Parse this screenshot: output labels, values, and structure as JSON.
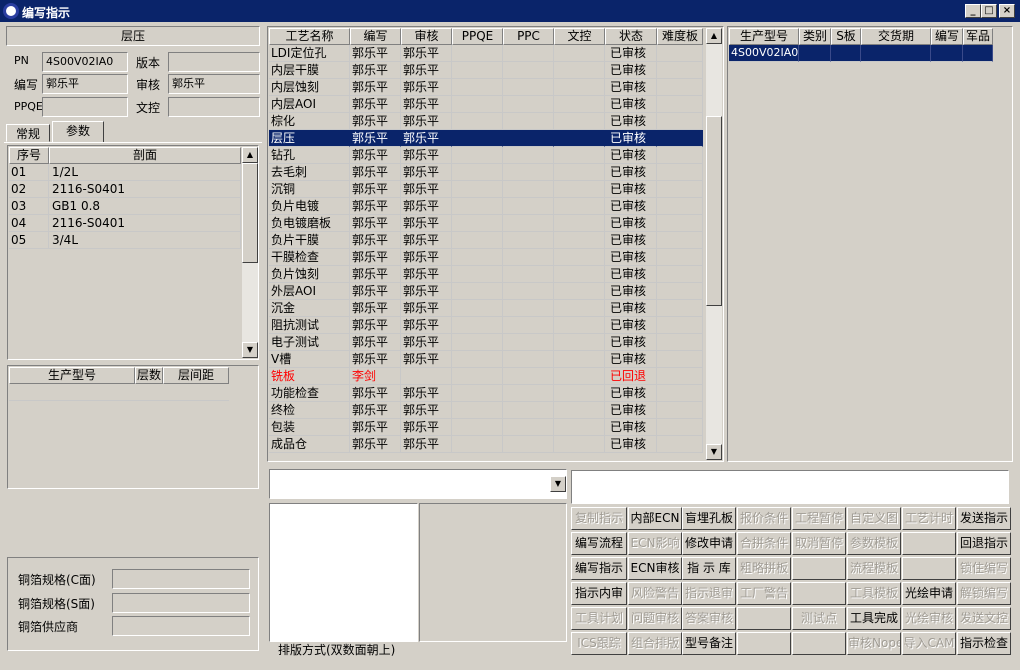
{
  "window": {
    "title": "编写指示",
    "min": "_",
    "max": "□",
    "close": "×"
  },
  "left": {
    "section_title": "层压",
    "pn_label": "PN",
    "pn_value": "4S00V02IA0",
    "version_label": "版本",
    "version_value": "",
    "writer_label": "编写",
    "writer_value": "郭乐平",
    "reviewer_label": "审核",
    "reviewer_value": "郭乐平",
    "ppqe_label": "PPQE",
    "ppqe_value": "",
    "doccontrol_label": "文控",
    "doccontrol_value": "",
    "tabs": [
      {
        "label": "常规"
      },
      {
        "label": "参数"
      }
    ],
    "profile_headers": {
      "seq": "序号",
      "section": "剖面"
    },
    "profiles": [
      {
        "seq": "01",
        "section": "1/2L"
      },
      {
        "seq": "02",
        "section": "2116-S0401"
      },
      {
        "seq": "03",
        "section": "GB1  0.8"
      },
      {
        "seq": "04",
        "section": "2116-S0401"
      },
      {
        "seq": "05",
        "section": "3/4L"
      }
    ],
    "layer_headers": {
      "model": "生产型号",
      "layers": "层数",
      "spacing": "层间距"
    },
    "copper_c_label": "铜箔规格(C面)",
    "copper_c_value": "",
    "copper_s_label": "铜箔规格(S面)",
    "copper_s_value": "",
    "copper_supplier_label": "铜箔供应商",
    "copper_supplier_value": ""
  },
  "process_table": {
    "headers": [
      "工艺名称",
      "编写",
      "审核",
      "PPQE",
      "PPC",
      "文控",
      "状态",
      "难度板"
    ],
    "rows": [
      {
        "name": "LDI定位孔",
        "writer": "郭乐平",
        "reviewer": "郭乐平",
        "status": "已审核"
      },
      {
        "name": "内层干膜",
        "writer": "郭乐平",
        "reviewer": "郭乐平",
        "status": "已审核"
      },
      {
        "name": "内层蚀刻",
        "writer": "郭乐平",
        "reviewer": "郭乐平",
        "status": "已审核"
      },
      {
        "name": "内层AOI",
        "writer": "郭乐平",
        "reviewer": "郭乐平",
        "status": "已审核"
      },
      {
        "name": "棕化",
        "writer": "郭乐平",
        "reviewer": "郭乐平",
        "status": "已审核"
      },
      {
        "name": "层压",
        "writer": "郭乐平",
        "reviewer": "郭乐平",
        "status": "已审核",
        "selected": true
      },
      {
        "name": "钻孔",
        "writer": "郭乐平",
        "reviewer": "郭乐平",
        "status": "已审核"
      },
      {
        "name": "去毛刺",
        "writer": "郭乐平",
        "reviewer": "郭乐平",
        "status": "已审核"
      },
      {
        "name": "沉铜",
        "writer": "郭乐平",
        "reviewer": "郭乐平",
        "status": "已审核"
      },
      {
        "name": "负片电镀",
        "writer": "郭乐平",
        "reviewer": "郭乐平",
        "status": "已审核"
      },
      {
        "name": "负电镀磨板",
        "writer": "郭乐平",
        "reviewer": "郭乐平",
        "status": "已审核"
      },
      {
        "name": "负片干膜",
        "writer": "郭乐平",
        "reviewer": "郭乐平",
        "status": "已审核"
      },
      {
        "name": "干膜检查",
        "writer": "郭乐平",
        "reviewer": "郭乐平",
        "status": "已审核"
      },
      {
        "name": "负片蚀刻",
        "writer": "郭乐平",
        "reviewer": "郭乐平",
        "status": "已审核"
      },
      {
        "name": "外层AOI",
        "writer": "郭乐平",
        "reviewer": "郭乐平",
        "status": "已审核"
      },
      {
        "name": "沉金",
        "writer": "郭乐平",
        "reviewer": "郭乐平",
        "status": "已审核"
      },
      {
        "name": "阻抗测试",
        "writer": "郭乐平",
        "reviewer": "郭乐平",
        "status": "已审核"
      },
      {
        "name": "电子测试",
        "writer": "郭乐平",
        "reviewer": "郭乐平",
        "status": "已审核"
      },
      {
        "name": "V槽",
        "writer": "郭乐平",
        "reviewer": "郭乐平",
        "status": "已审核"
      },
      {
        "name": "铣板",
        "writer": "李剑",
        "reviewer": "",
        "status": "已回退",
        "returned": true
      },
      {
        "name": "功能检查",
        "writer": "郭乐平",
        "reviewer": "郭乐平",
        "status": "已审核"
      },
      {
        "name": "终检",
        "writer": "郭乐平",
        "reviewer": "郭乐平",
        "status": "已审核"
      },
      {
        "name": "包装",
        "writer": "郭乐平",
        "reviewer": "郭乐平",
        "status": "已审核"
      },
      {
        "name": "成品仓",
        "writer": "郭乐平",
        "reviewer": "郭乐平",
        "status": "已审核"
      }
    ]
  },
  "model_table": {
    "headers": [
      "生产型号",
      "类别",
      "S板",
      "交货期",
      "编写",
      "军品"
    ],
    "rows": [
      {
        "model": "4S00V02IA0"
      }
    ]
  },
  "layout_label": "排版方式(双数面朝上)",
  "buttons": [
    [
      {
        "label": "复制指示",
        "enabled": false
      },
      {
        "label": "内部ECN",
        "enabled": true
      },
      {
        "label": "盲埋孔板",
        "enabled": true
      },
      {
        "label": "报价条件",
        "enabled": false
      },
      {
        "label": "工程暂停",
        "enabled": false
      },
      {
        "label": "自定义图",
        "enabled": false
      },
      {
        "label": "工艺计时",
        "enabled": false
      },
      {
        "label": "发送指示",
        "enabled": true
      }
    ],
    [
      {
        "label": "编写流程",
        "enabled": true
      },
      {
        "label": "ECN影响",
        "enabled": false
      },
      {
        "label": "修改申请",
        "enabled": true
      },
      {
        "label": "合拼条件",
        "enabled": false
      },
      {
        "label": "取消暂停",
        "enabled": false
      },
      {
        "label": "参数模板",
        "enabled": false
      },
      {
        "label": "",
        "enabled": false
      },
      {
        "label": "回退指示",
        "enabled": true
      }
    ],
    [
      {
        "label": "编写指示",
        "enabled": true
      },
      {
        "label": "ECN审核",
        "enabled": true
      },
      {
        "label": "指 示 库",
        "enabled": true
      },
      {
        "label": "粗略拼板",
        "enabled": false
      },
      {
        "label": "",
        "enabled": false
      },
      {
        "label": "流程模板",
        "enabled": false
      },
      {
        "label": "",
        "enabled": false
      },
      {
        "label": "锁住编写",
        "enabled": false
      }
    ],
    [
      {
        "label": "指示内审",
        "enabled": true
      },
      {
        "label": "风险警告",
        "enabled": false
      },
      {
        "label": "指示退审",
        "enabled": false
      },
      {
        "label": "工厂警告",
        "enabled": false
      },
      {
        "label": "",
        "enabled": false
      },
      {
        "label": "工具模板",
        "enabled": false
      },
      {
        "label": "光绘申请",
        "enabled": true
      },
      {
        "label": "解锁编写",
        "enabled": false
      }
    ],
    [
      {
        "label": "工具计划",
        "enabled": false
      },
      {
        "label": "问题审核",
        "enabled": false
      },
      {
        "label": "答案审核",
        "enabled": false
      },
      {
        "label": "",
        "enabled": false
      },
      {
        "label": "测试点",
        "enabled": false
      },
      {
        "label": "工具完成",
        "enabled": true
      },
      {
        "label": "光绘审核",
        "enabled": false
      },
      {
        "label": "发送文控",
        "enabled": false
      }
    ],
    [
      {
        "label": "ICS跟踪",
        "enabled": false
      },
      {
        "label": "组合排版",
        "enabled": false
      },
      {
        "label": "型号备注",
        "enabled": true
      },
      {
        "label": "",
        "enabled": false
      },
      {
        "label": "",
        "enabled": false
      },
      {
        "label": "审核Nope",
        "enabled": false
      },
      {
        "label": "导入CAM",
        "enabled": false
      },
      {
        "label": "指示检查",
        "enabled": true
      }
    ]
  ],
  "colors": {
    "selected_bg": "#0a246a",
    "returned_text": "#ff0000",
    "title_bg": "#0a246a"
  }
}
